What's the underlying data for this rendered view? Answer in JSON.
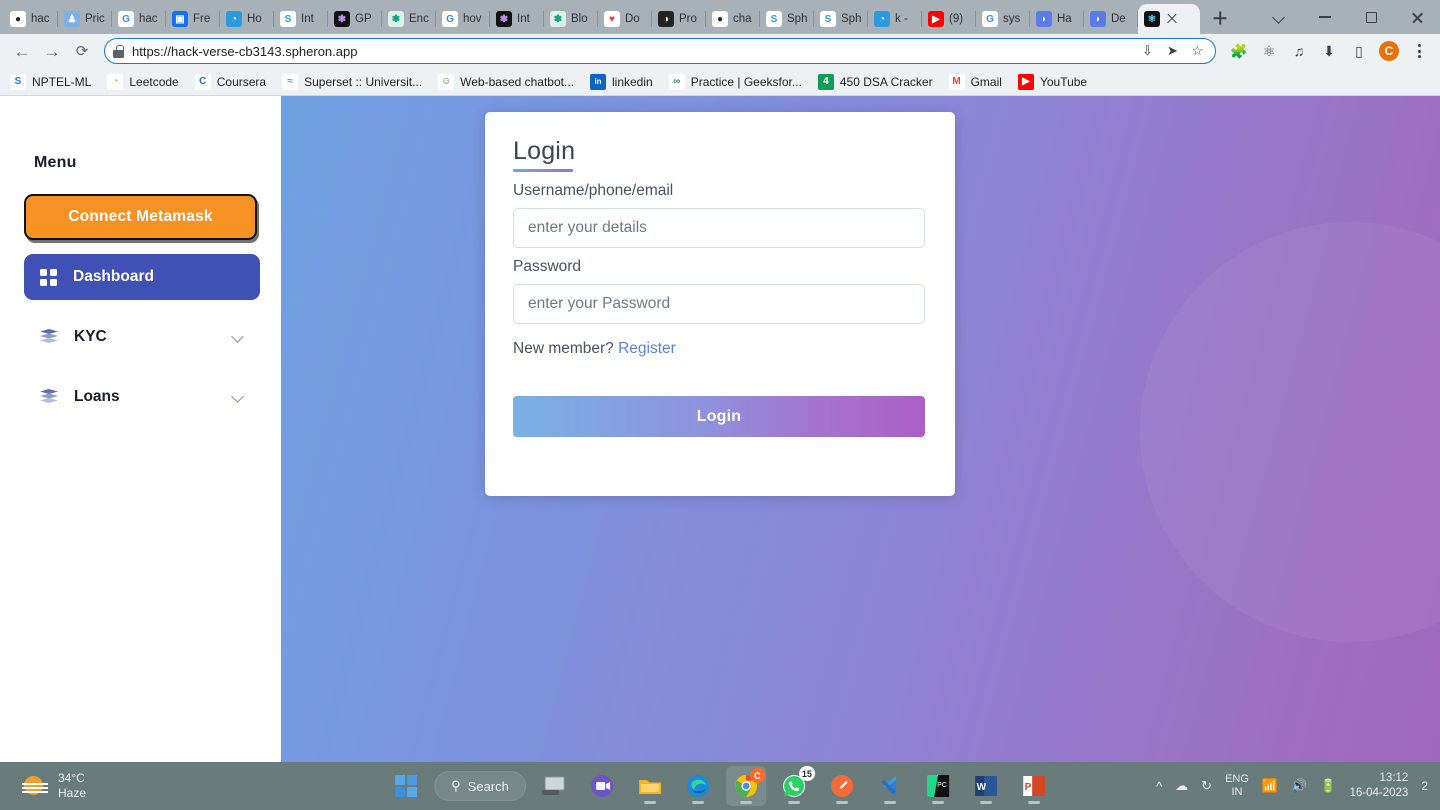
{
  "browser": {
    "tabs": [
      {
        "label": "hac",
        "icon": "github-icon",
        "active": false
      },
      {
        "label": "Pric",
        "icon": "people-icon",
        "active": false
      },
      {
        "label": "hac",
        "icon": "google-icon",
        "active": false
      },
      {
        "label": "Fre",
        "icon": "freepik-icon",
        "active": false
      },
      {
        "label": "Ho",
        "icon": "edge-icon",
        "active": false
      },
      {
        "label": "Int",
        "icon": "spheron-icon",
        "active": false
      },
      {
        "label": "GP",
        "icon": "openai-dark-icon",
        "active": false
      },
      {
        "label": "Enc",
        "icon": "openai-icon",
        "active": false
      },
      {
        "label": "hov",
        "icon": "google-icon",
        "active": false
      },
      {
        "label": "Int",
        "icon": "openai-dark-icon",
        "active": false
      },
      {
        "label": "Blo",
        "icon": "openai-icon",
        "active": false
      },
      {
        "label": "Do",
        "icon": "heart-icon",
        "active": false
      },
      {
        "label": "Pro",
        "icon": "globe-icon",
        "active": false
      },
      {
        "label": "cha",
        "icon": "github-icon",
        "active": false
      },
      {
        "label": "Sph",
        "icon": "spheron-icon",
        "active": false
      },
      {
        "label": "Sph",
        "icon": "spheron-icon",
        "active": false
      },
      {
        "label": "k -",
        "icon": "edge-icon",
        "active": false
      },
      {
        "label": "(9)",
        "icon": "youtube-icon",
        "active": false
      },
      {
        "label": "sys",
        "icon": "google-icon",
        "active": false
      },
      {
        "label": "Ha",
        "icon": "blue-drop-icon",
        "active": false
      },
      {
        "label": "De",
        "icon": "blue-drop-icon",
        "active": false
      },
      {
        "label": "",
        "icon": "react-icon",
        "active": true
      }
    ],
    "new_tab_label": "+",
    "window_controls": {
      "tab_search": "tab-search",
      "minimize": "minimize",
      "maximize": "maximize",
      "close": "close"
    },
    "toolbar": {
      "back": "Back",
      "forward": "Forward",
      "reload": "Reload",
      "url": "https://hack-verse-cb3143.spheron.app",
      "install_icon": "install-icon",
      "share_icon": "share-icon",
      "bookmark_icon": "star-icon",
      "extensions_icon": "puzzle-icon",
      "privacy_icon": "leaf-shield-icon",
      "media_icon": "media-list-icon",
      "downloads_icon": "download-icon",
      "sidepanel_icon": "side-panel-icon",
      "profile_initial": "C",
      "menu_icon": "kebab-menu-icon"
    },
    "bookmarks": [
      {
        "label": "NPTEL-ML",
        "icon": "swayam-icon"
      },
      {
        "label": "Leetcode",
        "icon": "leetcode-icon"
      },
      {
        "label": "Coursera",
        "icon": "coursera-icon"
      },
      {
        "label": "Superset :: Universit...",
        "icon": "superset-icon"
      },
      {
        "label": "Web-based chatbot...",
        "icon": "chatbot-icon"
      },
      {
        "label": "linkedin",
        "icon": "linkedin-icon"
      },
      {
        "label": "Practice | Geeksfor...",
        "icon": "geeksforgeeks-icon"
      },
      {
        "label": "450 DSA Cracker",
        "icon": "sheet-icon"
      },
      {
        "label": "Gmail",
        "icon": "gmail-icon"
      },
      {
        "label": "YouTube",
        "icon": "youtube-icon"
      }
    ]
  },
  "sidebar": {
    "title": "Menu",
    "connect_button": "Connect Metamask",
    "items": [
      {
        "label": "Dashboard",
        "icon": "grid-icon",
        "active": true,
        "expandable": false
      },
      {
        "label": "KYC",
        "icon": "layers-icon",
        "active": false,
        "expandable": true
      },
      {
        "label": "Loans",
        "icon": "layers-icon",
        "active": false,
        "expandable": true
      }
    ]
  },
  "login_card": {
    "title": "Login",
    "username_label": "Username/phone/email",
    "username_placeholder": "enter your details",
    "username_value": "",
    "password_label": "Password",
    "password_placeholder": "enter your Password",
    "password_value": "",
    "register_prompt": "New member? ",
    "register_link": "Register",
    "submit_label": "Login"
  },
  "colors": {
    "metamask_orange": "#f59223",
    "dashboard_blue": "#3f51b5",
    "link_blue": "#5f7fe0",
    "gradient_start": "#6fa0e2",
    "gradient_end": "#a067bd"
  },
  "taskbar": {
    "weather": {
      "temperature": "34°C",
      "condition": "Haze",
      "icon": "haze-sun-icon"
    },
    "start_icon": "windows-start-icon",
    "search_label": "Search",
    "search_icon": "search-icon",
    "apps": [
      {
        "name": "task-view",
        "icon": "task-view-icon",
        "running": false,
        "badge": ""
      },
      {
        "name": "teams",
        "icon": "teams-icon",
        "running": false,
        "badge": ""
      },
      {
        "name": "file-explorer",
        "icon": "folder-icon",
        "running": true,
        "badge": ""
      },
      {
        "name": "edge",
        "icon": "edge-icon",
        "running": true,
        "badge": ""
      },
      {
        "name": "chrome",
        "icon": "chrome-icon",
        "running": true,
        "badge": "C",
        "active": true
      },
      {
        "name": "whatsapp",
        "icon": "whatsapp-icon",
        "running": true,
        "badge": "15"
      },
      {
        "name": "postman",
        "icon": "postman-icon",
        "running": true,
        "badge": ""
      },
      {
        "name": "vscode",
        "icon": "vscode-icon",
        "running": true,
        "badge": ""
      },
      {
        "name": "pycharm",
        "icon": "pycharm-icon",
        "running": true,
        "badge": ""
      },
      {
        "name": "word",
        "icon": "word-icon",
        "running": true,
        "badge": ""
      },
      {
        "name": "powerpoint",
        "icon": "powerpoint-icon",
        "running": true,
        "badge": ""
      }
    ],
    "tray": {
      "overflow_icon": "chevron-up-icon",
      "onedrive_icon": "onedrive-icon",
      "sync_icon": "sync-icon",
      "language": "ENG",
      "region": "IN",
      "wifi_icon": "wifi-icon",
      "volume_icon": "speaker-icon",
      "battery_icon": "battery-icon",
      "time": "13:12",
      "date": "16-04-2023",
      "notification_count": "2"
    }
  }
}
